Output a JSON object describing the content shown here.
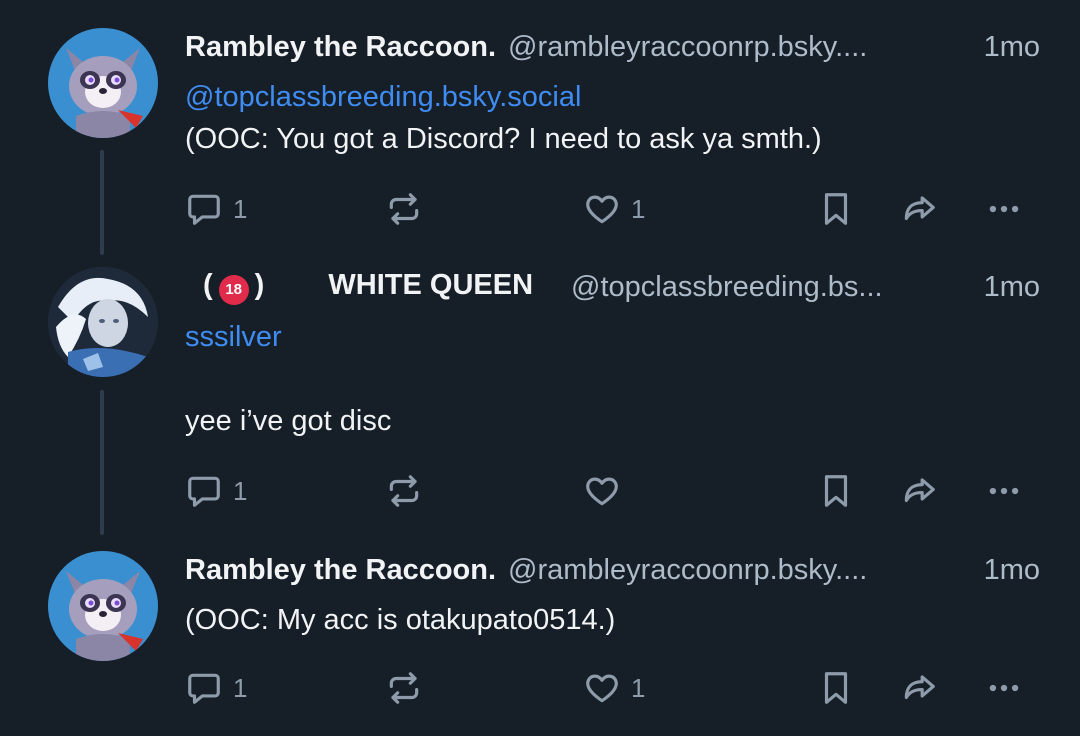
{
  "posts": [
    {
      "display_name": "Rambley the Raccoon.",
      "handle": "@rambleyraccoonrp.bsky....",
      "time": "1mo",
      "mention": "@topclassbreeding.bsky.social",
      "text": "(OOC: You got a Discord? I need to ask ya smth.)",
      "reply_count": "1",
      "like_count": "1"
    },
    {
      "name_prefix": "(",
      "badge": "18",
      "name_suffix": ")",
      "display_name": "WHITE QUEEN",
      "handle": "@topclassbreeding.bs...",
      "time": "1mo",
      "subname": "sssilver",
      "text": "yee i’ve got disc",
      "reply_count": "1",
      "like_count": ""
    },
    {
      "display_name": "Rambley the Raccoon.",
      "handle": "@rambleyraccoonrp.bsky....",
      "time": "1mo",
      "text": "(OOC: My acc is otakupato0514.)",
      "reply_count": "1",
      "like_count": "1"
    }
  ],
  "colors": {
    "background": "#161e27",
    "link": "#3f8cf2",
    "muted": "#8d9bab",
    "badge": "#e02c4a"
  },
  "icons": [
    "reply-icon",
    "repost-icon",
    "like-icon",
    "bookmark-icon",
    "share-icon",
    "more-icon"
  ]
}
